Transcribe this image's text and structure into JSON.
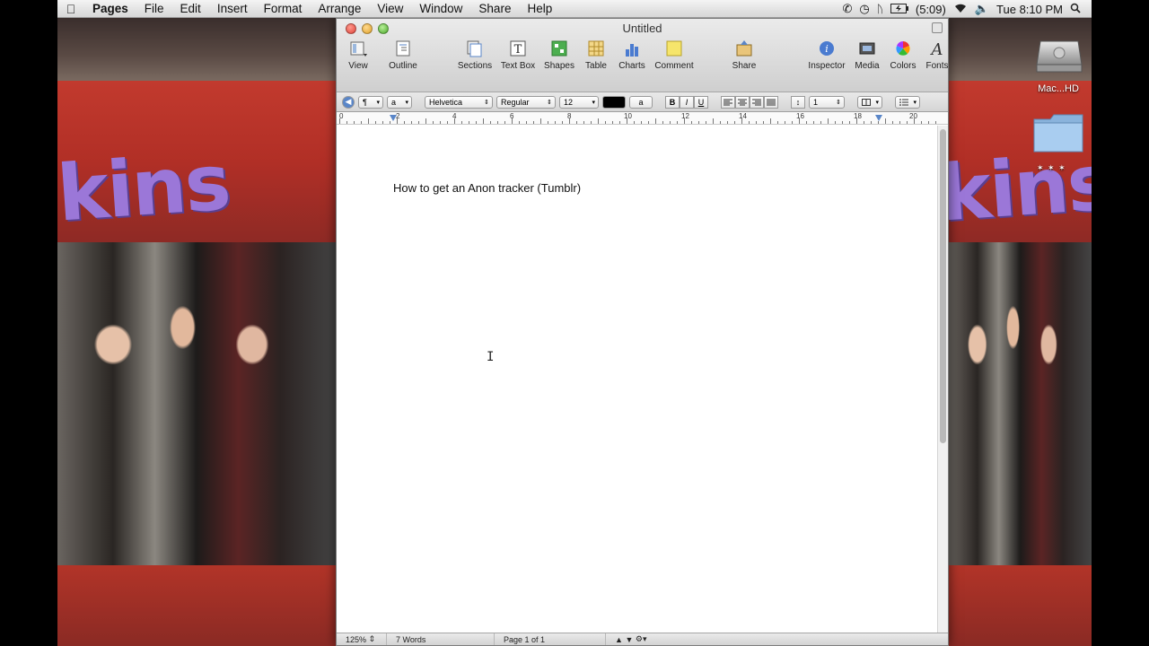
{
  "menubar": {
    "apple_icon": "apple-icon",
    "items": [
      "Pages",
      "File",
      "Edit",
      "Insert",
      "Format",
      "Arrange",
      "View",
      "Window",
      "Share",
      "Help"
    ],
    "status": {
      "battery": "(5:09)",
      "clock": "Tue 8:10 PM",
      "icons": [
        "phone-icon",
        "time-machine-icon",
        "bluetooth-icon",
        "battery-icon",
        "wifi-icon",
        "volume-icon",
        "spotlight-icon"
      ]
    }
  },
  "desktop": {
    "disk_label": "Mac...HD",
    "folder_label": "✶ ✶ ✶"
  },
  "window": {
    "title": "Untitled",
    "toolbar": {
      "view": "View",
      "outline": "Outline",
      "sections": "Sections",
      "textbox": "Text Box",
      "shapes": "Shapes",
      "table": "Table",
      "charts": "Charts",
      "comment": "Comment",
      "share": "Share",
      "inspector": "Inspector",
      "media": "Media",
      "colors": "Colors",
      "fonts": "Fonts"
    },
    "formatbar": {
      "paragraph_style": "¶",
      "char_style": "a",
      "font_family": "Helvetica",
      "font_style": "Regular",
      "font_size": "12",
      "text_color": "#000000",
      "highlight_label": "a",
      "bold": "B",
      "italic": "I",
      "underline": "U",
      "line_spacing": "1"
    },
    "ruler": {
      "numbers": [
        "0",
        "2",
        "4",
        "6",
        "8",
        "10",
        "12",
        "14",
        "16",
        "18",
        "20"
      ]
    },
    "document": {
      "text": "How to get an Anon tracker (Tumblr)"
    },
    "statusbar": {
      "zoom": "125%",
      "word_count": "7 Words",
      "page": "Page 1 of 1"
    }
  },
  "colors": {
    "wallpaper_red": "#c23a2e",
    "wallpaper_purple": "#9b77d8"
  }
}
